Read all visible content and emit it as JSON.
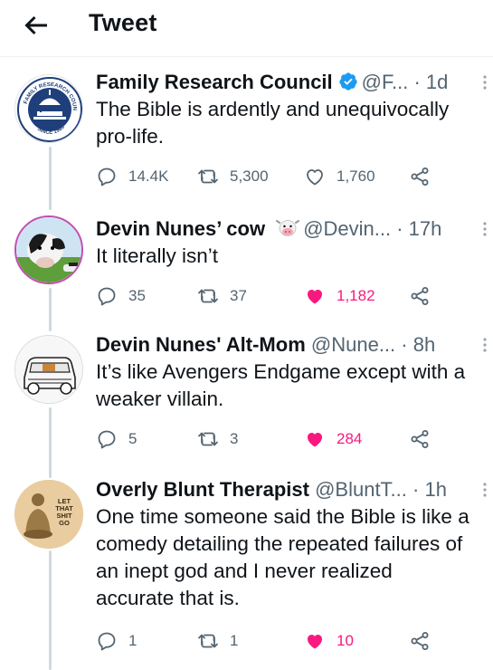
{
  "header": {
    "title": "Tweet"
  },
  "tweets": [
    {
      "name": "Family Research Council",
      "handle": "@F...",
      "time": "· 1d",
      "text": "The Bible is ardently and unequivocally\npro-life.",
      "avatar_text": "FAMILY RESEARCH COUNCIL",
      "avatar_sub": "SINCE 1983",
      "replies": "14.4K",
      "retweets": "5,300",
      "likes": "1,760",
      "liked": false
    },
    {
      "name": "Devin Nunes’ cow",
      "handle": "@Devin...",
      "time": "· 17h",
      "text": "It literally isn’t",
      "replies": "35",
      "retweets": "37",
      "likes": "1,182",
      "liked": true
    },
    {
      "name": "Devin Nunes' Alt-Mom",
      "handle": "@Nune...",
      "time": "· 8h",
      "text": "It’s like Avengers Endgame except with a\nweaker villain.",
      "replies": "5",
      "retweets": "3",
      "likes": "284",
      "liked": true
    },
    {
      "name": "Overly Blunt Therapist",
      "handle": "@BluntT...",
      "time": "· 1h",
      "text": "One time someone said the Bible is like a\ncomedy detailing the repeated failures of\nan inept god and I never realized\naccurate that is.",
      "avatar_text": "LET THAT SHIT GO",
      "replies": "1",
      "retweets": "1",
      "likes": "10",
      "liked": true
    }
  ],
  "colors": {
    "like": "#f91880",
    "muted": "#536471",
    "verified": "#1d9bf0"
  }
}
